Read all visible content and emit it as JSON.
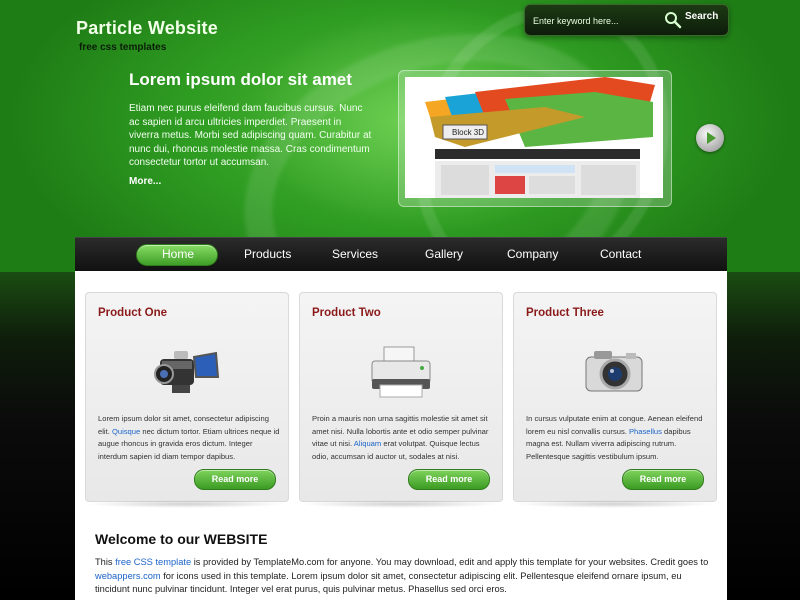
{
  "site": {
    "title": "Particle Website",
    "tagline": "free css templates"
  },
  "search": {
    "placeholder": "Enter keyword here...",
    "button_label": "Search"
  },
  "hero": {
    "title": "Lorem ipsum dolor sit amet",
    "text": "Etiam nec purus eleifend dam faucibus cursus. Nunc ac sapien id arcu ultricies imperdiet. Praesent in viverra metus. Morbi sed adipiscing quam. Curabitur at nunc dui, rhoncus molestie massa. Cras condimentum consectetur tortor ut accumsan.",
    "more_label": "More..."
  },
  "preview": {
    "caption": "Block 3D"
  },
  "nav": {
    "items": [
      "Home",
      "Products",
      "Services",
      "Gallery",
      "Company",
      "Contact"
    ],
    "active": "Home"
  },
  "products": [
    {
      "title": "Product One",
      "icon": "video-camera-icon",
      "text_before": "Lorem ipsum dolor sit amet, consectetur adipiscing elit. ",
      "link": "Quisque",
      "text_after": " nec dictum tortor. Etiam ultrices neque id augue rhoncus in gravida eros dictum. Integer interdum sapien id diam tempor dapibus.",
      "button": "Read more"
    },
    {
      "title": "Product Two",
      "icon": "printer-icon",
      "text_before": "Proin a mauris non urna sagittis molestie sit amet sit amet nisi. Nulla lobortis ante et odio semper pulvinar vitae ut nisi. ",
      "link": "Aliquam",
      "text_after": " erat volutpat. Quisque lectus odio, accumsan id auctor ut, sodales at nisi.",
      "button": "Read more"
    },
    {
      "title": "Product Three",
      "icon": "photo-camera-icon",
      "text_before": "In cursus vulputate enim at congue. Aenean eleifend lorem eu nisl convallis cursus. ",
      "link": "Phasellus",
      "text_after": " dapibus magna est. Nullam viverra adipiscing rutrum. Pellentesque sagittis vestibulum ipsum.",
      "button": "Read more"
    }
  ],
  "welcome": {
    "heading": "Welcome to our WEBSITE",
    "p1": "This ",
    "link1": "free CSS template",
    "p2": " is provided by TemplateMo.com for anyone. You may download, edit and apply this template for your websites. Credit goes to ",
    "link2": "webappers.com",
    "p3": " for icons used in this template. Lorem ipsum dolor sit amet, consectetur adipiscing elit. Pellentesque eleifend ornare ipsum, eu tincidunt nunc pulvinar tincidunt. Integer vel erat purus, quis pulvinar metus. Phasellus sed orci eros."
  },
  "colors": {
    "accent_green": "#3e9e26",
    "product_title": "#8b1a1a",
    "link_blue": "#1c64c8"
  }
}
